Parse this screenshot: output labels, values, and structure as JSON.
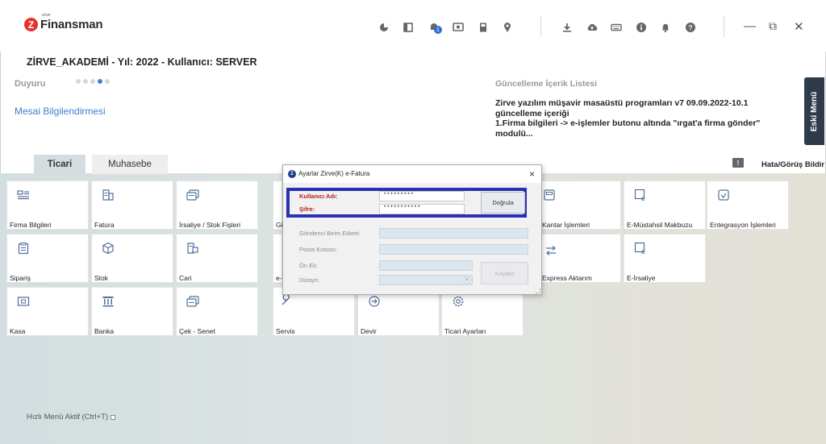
{
  "app": {
    "logo_small": "zirve",
    "logo_big": "Finansman",
    "header_title": "ZİRVE_AKADEMİ - Yıl: 2022 - Kullanıcı: SERVER"
  },
  "toolbar": {
    "icons": [
      "chart-pie-icon",
      "panel-icon",
      "notifications-badge-icon",
      "screen-icon",
      "book-icon",
      "location-icon",
      "download-icon",
      "cloud-upload-icon",
      "keyboard-icon",
      "info-icon",
      "bell-icon",
      "help-icon"
    ],
    "badge_count": "1"
  },
  "window_controls": {
    "minimize": "—",
    "restore": "⧉",
    "close": "✕"
  },
  "announcement": {
    "label": "Duyuru",
    "dots": 5,
    "active_dot": 4,
    "link": "Mesai Bilgilendirmesi"
  },
  "update": {
    "title": "Güncelleme İçerik Listesi",
    "text": "Zirve yazılım müşavir masaüstü programları v7 09.09.2022-10.1 güncelleme içeriği\n1.Firma bilgileri -> e-işlemler butonu altında \"ırgat'a firma gönder\" modulü..."
  },
  "side_button": {
    "label": "Eski Menü"
  },
  "tabs": [
    {
      "label": "Ticari",
      "active": true
    },
    {
      "label": "Muhasebe",
      "active": false
    }
  ],
  "feedback": {
    "label": "Hata/Görüş Bildir"
  },
  "tiles": [
    {
      "label": "Firma Bilgileri",
      "icon": "id-card-icon"
    },
    {
      "label": "Fatura",
      "icon": "invoice-icon"
    },
    {
      "label": "İrsaliye / Stok Fişleri",
      "icon": "waybill-icon"
    },
    {
      "label": "Gi",
      "icon": "hidden-icon"
    },
    {
      "label": "Kantar İşlemleri",
      "icon": "scale-icon"
    },
    {
      "label": "E-Müstahsil Makbuzu",
      "icon": "e-receipt-icon"
    },
    {
      "label": "Entegrasyon İşlemleri",
      "icon": "integration-icon"
    },
    {
      "label": "Sipariş",
      "icon": "order-icon"
    },
    {
      "label": "Stok",
      "icon": "box-icon"
    },
    {
      "label": "Cari",
      "icon": "account-icon"
    },
    {
      "label": "e-",
      "icon": "hidden-icon"
    },
    {
      "label": "Express Aktarım",
      "icon": "transfer-icon"
    },
    {
      "label": "E-İrsaliye",
      "icon": "e-waybill-icon"
    },
    {
      "label": "Kasa",
      "icon": "cash-icon"
    },
    {
      "label": "Banka",
      "icon": "bank-icon"
    },
    {
      "label": "Çek - Senet",
      "icon": "cheque-icon"
    },
    {
      "label": "Servis",
      "icon": "wrench-icon"
    },
    {
      "label": "Devir",
      "icon": "rollover-icon"
    },
    {
      "label": "Ticari Ayarları",
      "icon": "settings-icon"
    }
  ],
  "quick_menu": {
    "label": "Hızlı Menü Aktif (Ctrl+T)"
  },
  "dialog": {
    "title": "Ayarlar Zirve(K) e-Fatura",
    "title_icon_letter": "Z",
    "close": "×",
    "username_label": "Kullanıcı Adı:",
    "username_value": "*********",
    "password_label": "Şifre:",
    "password_value": "***********",
    "verify_button": "Doğrula",
    "sender_label": "Gönderici Birim Etiketi:",
    "mailbox_label": "Posta Kutusu:",
    "prefix_label": "Ön Ek:",
    "template_label": "Dizayn:",
    "save_button": "Kaydet"
  }
}
